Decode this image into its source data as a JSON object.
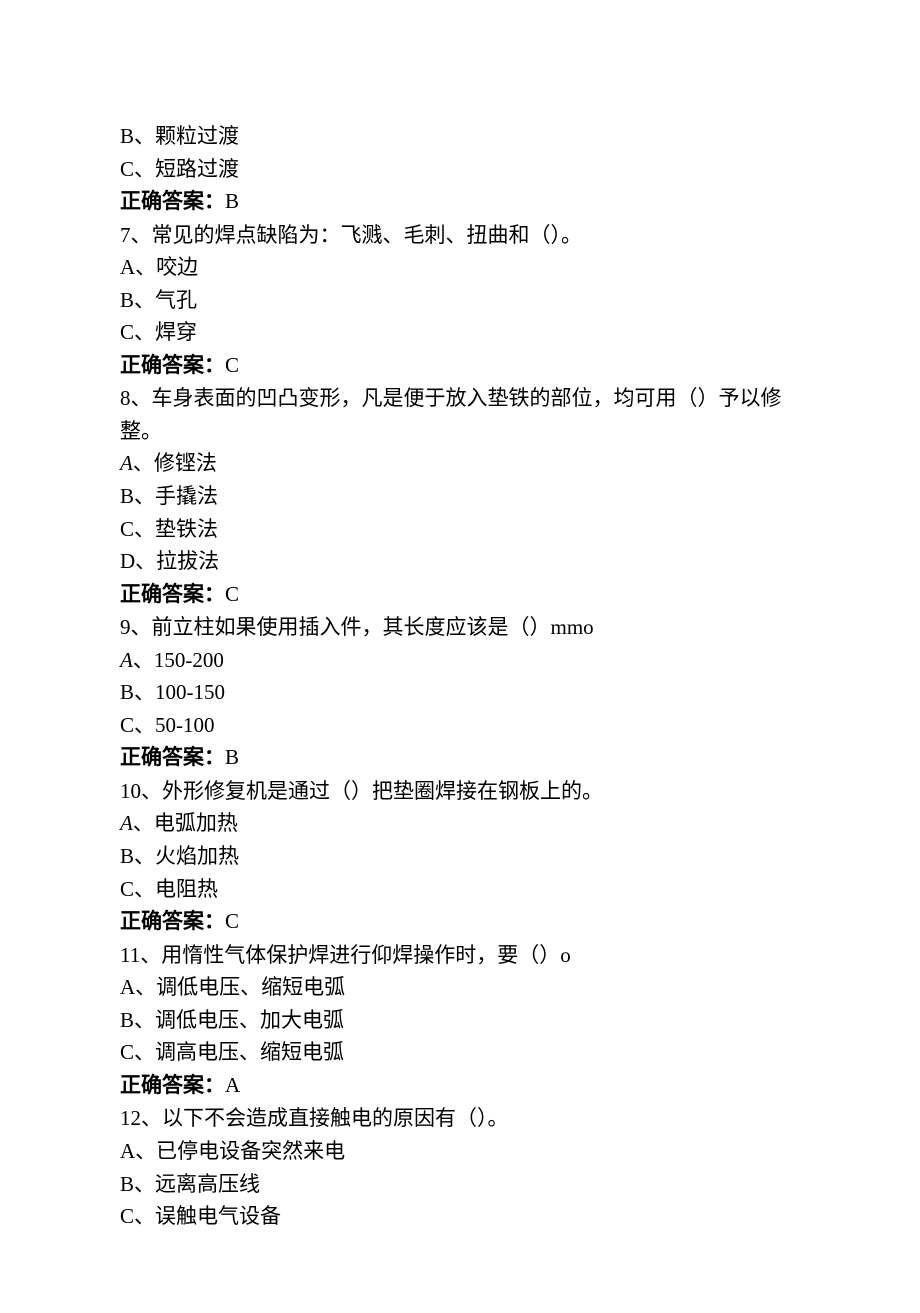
{
  "lines": [
    {
      "text": "B、颗粒过渡"
    },
    {
      "text": "C、短路过渡"
    },
    {
      "answerLabel": "正确答案：",
      "answerValue": "B"
    },
    {
      "text": "7、常见的焊点缺陷为：飞溅、毛刺、扭曲和（）。"
    },
    {
      "text": "A、咬边"
    },
    {
      "text": "B、气孔"
    },
    {
      "text": "C、焊穿"
    },
    {
      "answerLabel": "正确答案：",
      "answerValue": "C"
    },
    {
      "text": "8、车身表面的凹凸变形，凡是便于放入垫铁的部位，均可用（）予以修整。"
    },
    {
      "italicLetter": "A",
      "optionRest": "、修铿法"
    },
    {
      "text": "B、手撬法"
    },
    {
      "text": "C、垫铁法"
    },
    {
      "text": "D、拉拔法"
    },
    {
      "answerLabel": "正确答案：",
      "answerValue": "C"
    },
    {
      "text": "9、前立柱如果使用插入件，其长度应该是（）mmo"
    },
    {
      "italicLetter": "A",
      "optionRest": "、150-200"
    },
    {
      "text": "B、100-150"
    },
    {
      "text": "C、50-100"
    },
    {
      "answerLabel": "正确答案：",
      "answerValue": "B"
    },
    {
      "text": "10、外形修复机是通过（）把垫圈焊接在钢板上的。"
    },
    {
      "italicLetter": "A",
      "optionRest": "、电弧加热"
    },
    {
      "text": "B、火焰加热"
    },
    {
      "text": "C、电阻热"
    },
    {
      "answerLabel": "正确答案：",
      "answerValue": "C"
    },
    {
      "text": "11、用惰性气体保护焊进行仰焊操作时，要（）o"
    },
    {
      "text": "A、调低电压、缩短电弧"
    },
    {
      "text": "B、调低电压、加大电弧"
    },
    {
      "text": "C、调高电压、缩短电弧"
    },
    {
      "answerLabel": "正确答案：",
      "answerValue": "A"
    },
    {
      "text": "12、以下不会造成直接触电的原因有（）。"
    },
    {
      "text": "A、已停电设备突然来电"
    },
    {
      "text": "B、远离高压线"
    },
    {
      "text": "C、误触电气设备"
    }
  ]
}
